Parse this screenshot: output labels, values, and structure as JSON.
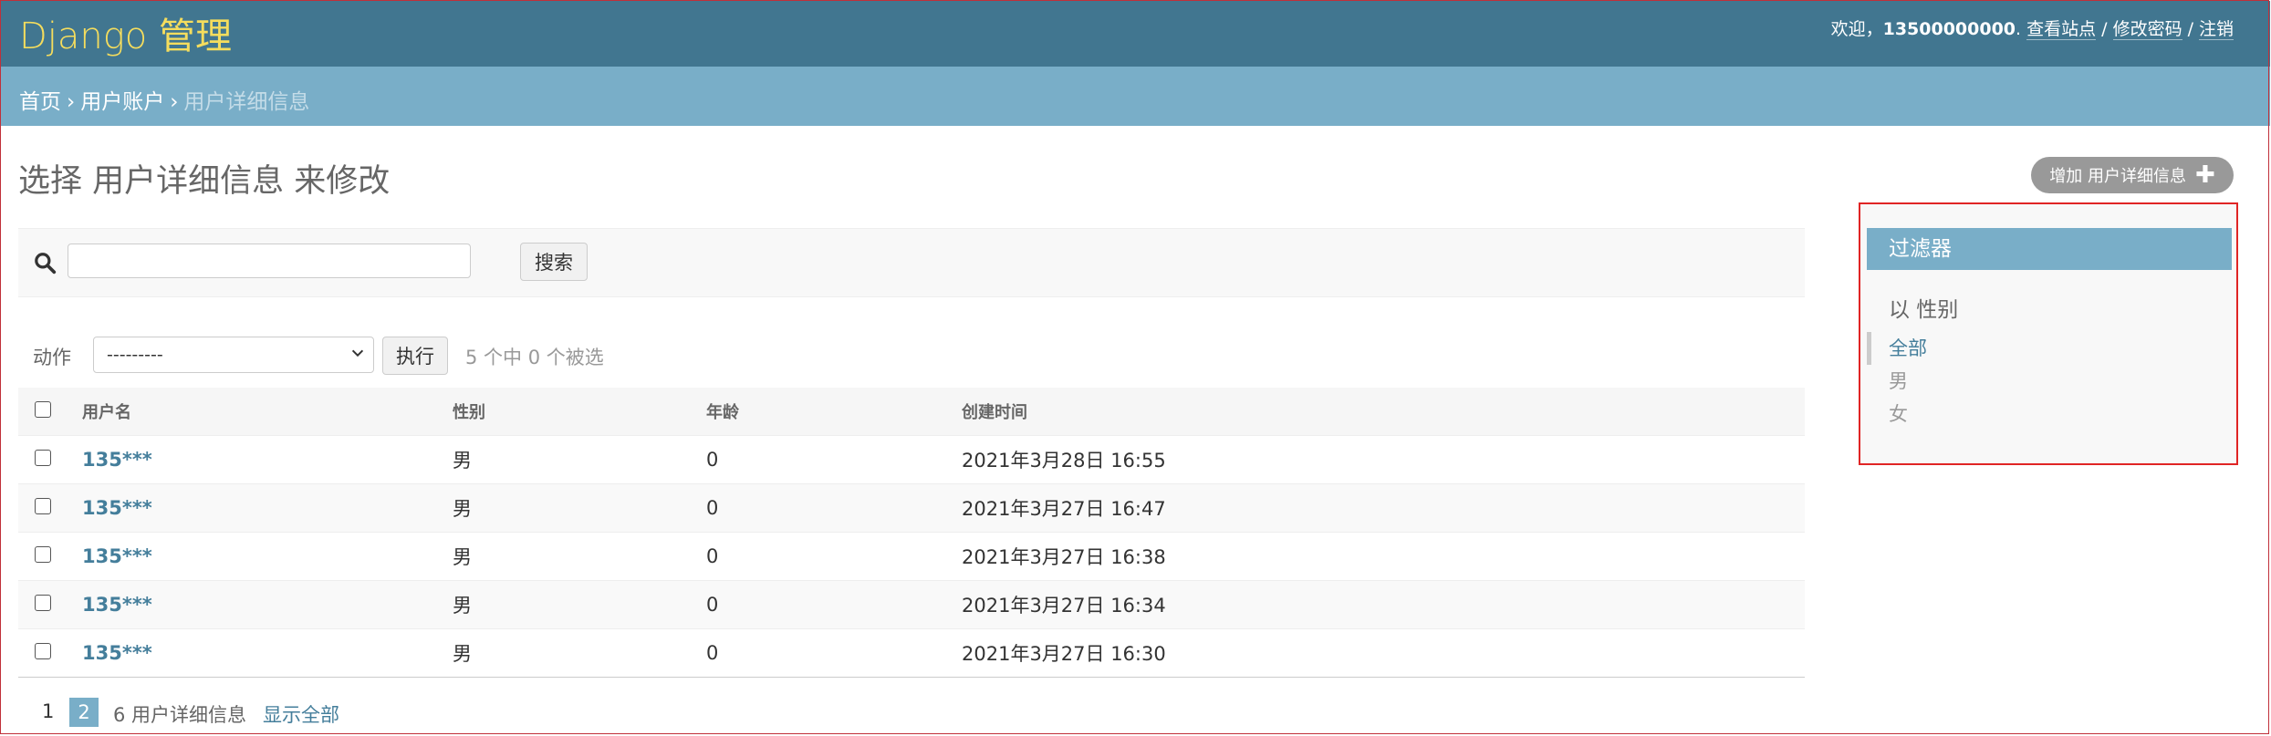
{
  "header": {
    "site_name": "Django 管理",
    "welcome": "欢迎，",
    "username": "13500000000",
    "view_site": "查看站点",
    "change_password": "修改密码",
    "logout": "注销"
  },
  "breadcrumbs": {
    "home": "首页",
    "app": "用户账户",
    "current": "用户详细信息"
  },
  "page": {
    "title": "选择 用户详细信息 来修改",
    "add_button": "增加 用户详细信息"
  },
  "search": {
    "value": "",
    "button": "搜索"
  },
  "actions": {
    "label": "动作",
    "selected": "---------",
    "go": "执行",
    "counter": "5 个中 0 个被选"
  },
  "table": {
    "headers": [
      "用户名",
      "性别",
      "年龄",
      "创建时间"
    ],
    "rows": [
      {
        "username": "135***",
        "gender": "男",
        "age": "0",
        "created": "2021年3月28日 16:55"
      },
      {
        "username": "135***",
        "gender": "男",
        "age": "0",
        "created": "2021年3月27日 16:47"
      },
      {
        "username": "135***",
        "gender": "男",
        "age": "0",
        "created": "2021年3月27日 16:38"
      },
      {
        "username": "135***",
        "gender": "男",
        "age": "0",
        "created": "2021年3月27日 16:34"
      },
      {
        "username": "135***",
        "gender": "男",
        "age": "0",
        "created": "2021年3月27日 16:30"
      }
    ]
  },
  "paginator": {
    "page1": "1",
    "page2": "2",
    "count": "6 用户详细信息",
    "show_all": "显示全部"
  },
  "filter": {
    "title": "过滤器",
    "by": "以 性别",
    "options": [
      "全部",
      "男",
      "女"
    ]
  },
  "colors": {
    "header_bg": "#417690",
    "breadcrumb_bg": "#79aec8",
    "site_name": "#f5dd5d",
    "link": "#447e9b",
    "highlight_border": "#e02525"
  },
  "icons": {
    "search": "search-icon",
    "add": "plus-icon",
    "select": "chevron-down-icon"
  }
}
